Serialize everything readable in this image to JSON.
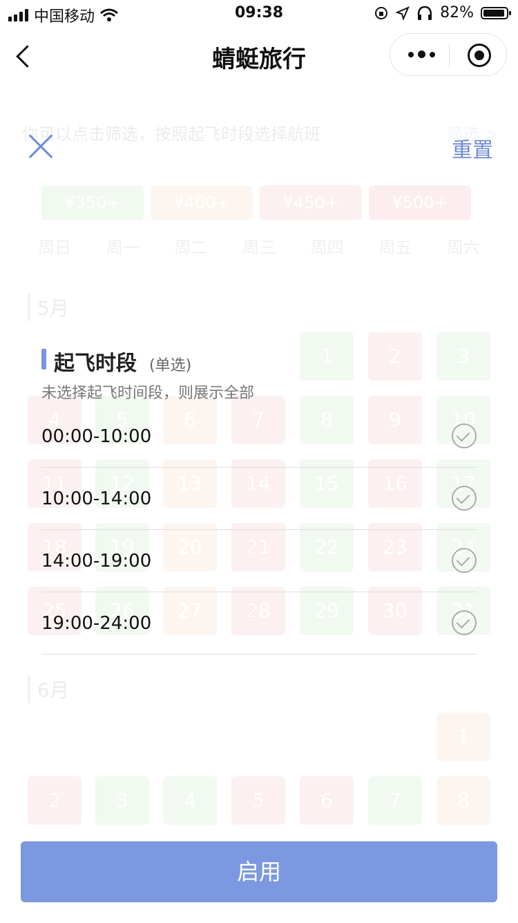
{
  "status_bar": {
    "carrier": "中国移动",
    "time": "09:38",
    "battery": "82%"
  },
  "nav": {
    "title": "蜻蜓旅行"
  },
  "background": {
    "hint": "你可以点击筛选，按照起飞时段选择航班",
    "filter": "筛选 >",
    "legend": [
      "¥350+",
      "¥400+",
      "¥450+",
      "¥500+"
    ],
    "weekdays": [
      "周日",
      "周一",
      "周二",
      "周三",
      "周四",
      "周五",
      "周六"
    ],
    "month_may": "5月",
    "month_june": "6月",
    "may_days": [
      "1",
      "2",
      "3",
      "4",
      "5",
      "6",
      "7",
      "8",
      "9",
      "10",
      "11",
      "12",
      "13",
      "14",
      "15",
      "16",
      "17",
      "18",
      "19",
      "20",
      "21",
      "22",
      "23",
      "24",
      "25",
      "26",
      "27",
      "28",
      "29",
      "30",
      "31"
    ],
    "june_days": [
      "1",
      "2",
      "3",
      "4",
      "5",
      "6",
      "7",
      "8"
    ]
  },
  "panel": {
    "reset_label": "重置",
    "section_title": "起飞时段",
    "section_sub": "(单选)",
    "section_desc": "未选择起飞时间段，则展示全部",
    "options": [
      "00:00-10:00",
      "10:00-14:00",
      "14:00-19:00",
      "19:00-24:00"
    ],
    "apply_label": "启用"
  },
  "colors": {
    "accent": "#7b98e0",
    "link": "#6d8bd6"
  }
}
